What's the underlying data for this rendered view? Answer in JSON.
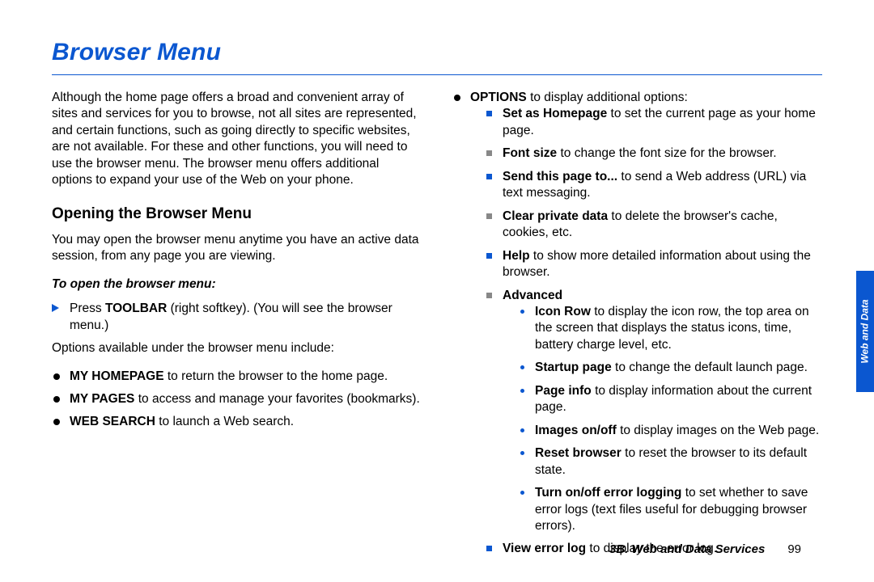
{
  "title": "Browser Menu",
  "intro": "Although the home page offers a broad and convenient array of sites and services for you to browse, not all sites are represented, and certain functions, such as going directly to specific websites, are not available. For these and other functions, you will need to use the browser menu. The browser menu offers additional options to expand your use of the Web on your phone.",
  "h2": "Opening the Browser Menu",
  "open_para": "You may open the browser menu anytime you have an active data session, from any page you are viewing.",
  "instr": "To open the browser menu:",
  "press": {
    "bold": "TOOLBAR",
    "pre": "Press ",
    "post": " (right softkey). (You will see the browser menu.)"
  },
  "options_intro": "Options available under the browser menu include:",
  "opts": {
    "homepage": {
      "b": "MY HOMEPAGE",
      "t": " to return the browser to the home page."
    },
    "pages": {
      "b": "MY PAGES",
      "t": " to access and manage your favorites (bookmarks)."
    },
    "search": {
      "b": "WEB SEARCH",
      "t": " to launch a Web search."
    },
    "options": {
      "b": "OPTIONS",
      "t": " to display additional options:"
    }
  },
  "sub": {
    "homepage": {
      "b": "Set as Homepage",
      "t": " to set the current page as your home page."
    },
    "font": {
      "b": "Font size",
      "t": " to change the font size for the browser."
    },
    "send": {
      "b": "Send this page to...",
      "t": " to send a Web address (URL) via text messaging."
    },
    "clear": {
      "b": "Clear private data",
      "t": " to delete the browser's cache, cookies, etc."
    },
    "help": {
      "b": "Help",
      "t": " to show more detailed information about using the browser."
    },
    "advanced": {
      "b": "Advanced"
    },
    "viewlog": {
      "b": "View error log",
      "t": " to display the error log."
    }
  },
  "adv": {
    "iconrow": {
      "b": "Icon Row",
      "t": " to display the icon row, the top area on the screen that displays the status icons, time, battery charge level, etc."
    },
    "startup": {
      "b": "Startup page",
      "t": " to change the default launch page."
    },
    "pageinfo": {
      "b": "Page info",
      "t": " to display information about the current page."
    },
    "images": {
      "b": "Images on/off",
      "t": " to display images on the Web page."
    },
    "reset": {
      "b": "Reset browser",
      "t": " to reset the browser to its default state."
    },
    "errlog": {
      "b": "Turn on/off error logging",
      "t": " to set whether to save error logs (text files useful for debugging browser errors)."
    }
  },
  "tab": "Web and Data",
  "footer": {
    "section": "3B. Web and Data Services",
    "page": "99"
  }
}
